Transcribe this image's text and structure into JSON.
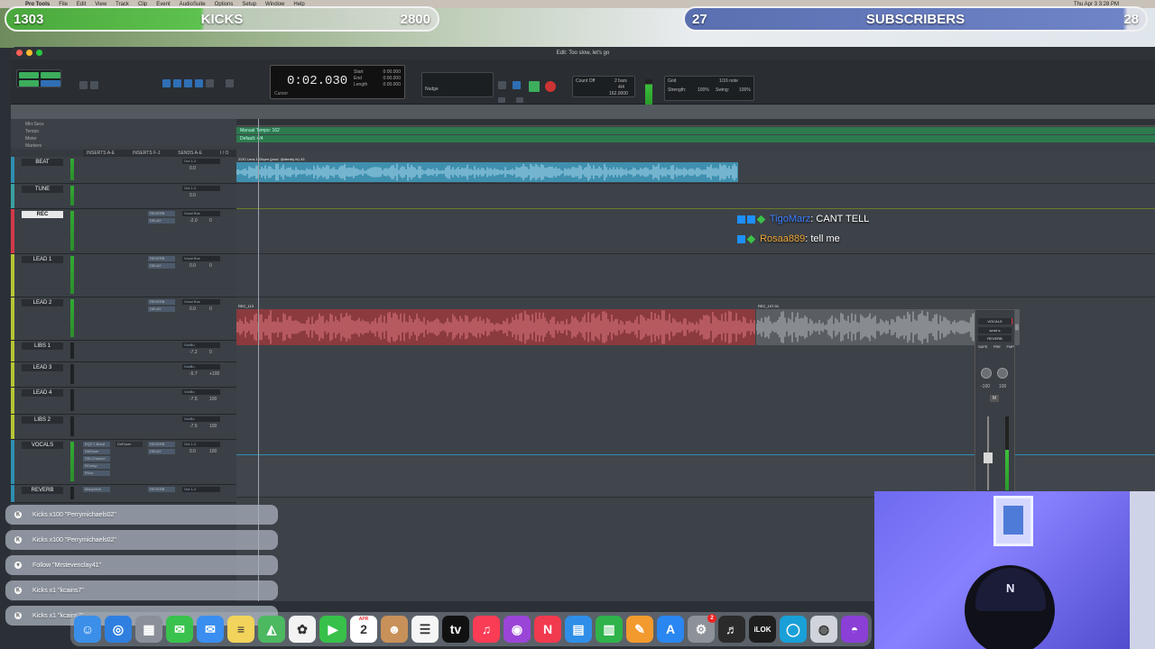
{
  "menubar": {
    "items": [
      "Pro Tools",
      "File",
      "Edit",
      "View",
      "Track",
      "Clip",
      "Event",
      "AudioSuite",
      "Options",
      "Setup",
      "Window",
      "Help"
    ],
    "clock": "Thu Apr 3  3:28 PM"
  },
  "overlays": {
    "kicks_goal": {
      "current": "1303",
      "label": "KICKS",
      "target": "2800",
      "progress": 0.47
    },
    "subs_goal": {
      "current": "27",
      "label": "SUBSCRIBERS",
      "target": "28",
      "progress": 0.96
    }
  },
  "window": {
    "title": "Edit: Too slow, let's go",
    "counter_main": "0:02.030",
    "counter_label": "Cursor",
    "sel_labels": [
      "Start",
      "End",
      "Length"
    ],
    "sel_values": [
      "0:00.000",
      "0:00.000",
      "0:00.000"
    ],
    "nudge_label": "Nudge",
    "grid_label": "Grid",
    "grid_value": "1/16 note",
    "strength_label": "Strength:",
    "strength_value": "100%",
    "swing_label": "Swing:",
    "swing_value": "100%",
    "tempo_value": "162.0000",
    "meter_value": "4/4",
    "count_off": "Count Off",
    "bars": "2 bars"
  },
  "rulers": [
    "Min:Secs",
    "Tempo",
    "Meter",
    "Markers"
  ],
  "ruler_values": {
    "tempo": "Manual Tempo: 162",
    "meter": "Default: 4/4"
  },
  "column_headers": [
    "INSERTS A-E",
    "INSERTS F-J",
    "SENDS A-E",
    "I / O"
  ],
  "tracks": [
    {
      "name": "BEAT",
      "io": "Out 1-2",
      "vol": "0.0",
      "color": "#2e8fb0",
      "active": false
    },
    {
      "name": "TUNE",
      "io": "Out 1-2",
      "vol": "0.0",
      "color": "#3aa0a0",
      "active": false
    },
    {
      "name": "REC",
      "io": "Vocal Bus",
      "send1": "REVERB",
      "send2": "DELAY",
      "vol": "-2.0",
      "pan": "0",
      "color": "#d23a48",
      "active": true
    },
    {
      "name": "LEAD 1",
      "io": "Vocal Bus",
      "send1": "REVERB",
      "send2": "DELAY",
      "vol": "0.0",
      "pan": "0",
      "color": "#b6c534",
      "active": false
    },
    {
      "name": "LEAD 2",
      "io": "Vocal Bus",
      "send1": "REVERB",
      "send2": "DELAY",
      "vol": "0.0",
      "pan": "0",
      "color": "#b6c534",
      "active": false
    },
    {
      "name": "LIBS 1",
      "io": "VoxBu",
      "vol": "-7.2",
      "pan": "0",
      "color": "#b6c534",
      "active": false
    },
    {
      "name": "LEAD 3",
      "io": "VoxBu",
      "vol": "-5.7",
      "pan": "+100",
      "color": "#b6c534",
      "active": false
    },
    {
      "name": "LEAD 4",
      "io": "VoxBu",
      "vol": "-7.5",
      "pan": "100",
      "color": "#b6c534",
      "active": false
    },
    {
      "name": "LIBS 2",
      "io": "VoxBu",
      "vol": "-7.5",
      "pan": "100",
      "color": "#b6c534",
      "active": false
    },
    {
      "name": "VOCALS",
      "io": "Out 1-2",
      "inserts": [
        "EQ3 7-Band",
        "DeEsser",
        "SSLChannel",
        "RComp",
        "RVox"
      ],
      "insert_b": "DeEsser",
      "send1": "REVERB",
      "send2": "DELAY",
      "vol": "0.0",
      "pan": "100",
      "color": "#2e8fb0",
      "active": false
    },
    {
      "name": "REVERB",
      "io": "Out 1-2",
      "insert": "ManyVerb",
      "send1": "REVERB",
      "color": "#2e8fb0",
      "active": false
    }
  ],
  "clips": [
    {
      "track": "BEAT",
      "name": "ZOO Lens 162bpm (prod. @drezily fx) 43",
      "color": "#3f8fae",
      "wave": "#a8d8ee"
    },
    {
      "track": "REC",
      "name": "REC_113",
      "color": "#8b3a3e",
      "wave": "#e27a82"
    },
    {
      "track": "REC",
      "name": "REC_107-01",
      "color": "#5a5e63",
      "wave": "#b7bbbf"
    }
  ],
  "chat": [
    {
      "user": "TigoMarz",
      "message": ": CANT TELL"
    },
    {
      "user": "Rosaa889",
      "message": ": tell me"
    }
  ],
  "float_mixer": {
    "name": "VOCALS",
    "send": "send a",
    "dest": "REVERB",
    "labels": [
      "SAFE",
      "PRE",
      "FMP"
    ],
    "pan_l": "-100",
    "pan_r": "100",
    "mute": "M"
  },
  "alerts": [
    {
      "icon": "K",
      "text": "Kicks x100 \"Perrymichaels02\""
    },
    {
      "icon": "K",
      "text": "Kicks x100 \"Perrymichaels02\""
    },
    {
      "icon": "♥",
      "text": "Follow \"Mrstevenclay41\""
    },
    {
      "icon": "K",
      "text": "Kicks x1 \"kcains7\""
    },
    {
      "icon": "K",
      "text": "Kicks x1 \"kcains7\""
    }
  ],
  "dock": {
    "apps": [
      {
        "name": "finder",
        "glyph": "☺",
        "color": "#3b8fe8"
      },
      {
        "name": "safari",
        "glyph": "◎",
        "color": "#2f7fe0"
      },
      {
        "name": "launchpad",
        "glyph": "▦",
        "color": "#8a8f99"
      },
      {
        "name": "messages",
        "glyph": "✉",
        "color": "#39c24e"
      },
      {
        "name": "mail",
        "glyph": "✉",
        "color": "#3a8ef0"
      },
      {
        "name": "notes",
        "glyph": "≡",
        "color": "#f2d35b"
      },
      {
        "name": "maps",
        "glyph": "◭",
        "color": "#4cb860"
      },
      {
        "name": "photos",
        "glyph": "✿",
        "color": "#f3f3f3"
      },
      {
        "name": "facetime",
        "glyph": "▶",
        "color": "#37c04a"
      },
      {
        "name": "calendar",
        "glyph": "2",
        "color": "#ffffff"
      },
      {
        "name": "contacts",
        "glyph": "☻",
        "color": "#c8915a"
      },
      {
        "name": "reminders",
        "glyph": "☰",
        "color": "#f5f5f5"
      },
      {
        "name": "tv",
        "glyph": "tv",
        "color": "#111111"
      },
      {
        "name": "music",
        "glyph": "♫",
        "color": "#fa3c55"
      },
      {
        "name": "podcasts",
        "glyph": "◉",
        "color": "#9b45d8"
      },
      {
        "name": "news",
        "glyph": "N",
        "color": "#f23a4f"
      },
      {
        "name": "keynote",
        "glyph": "▤",
        "color": "#2f8fe8"
      },
      {
        "name": "numbers",
        "glyph": "▥",
        "color": "#2fb34a"
      },
      {
        "name": "pages",
        "glyph": "✎",
        "color": "#f29a2e"
      },
      {
        "name": "app-store",
        "glyph": "A",
        "color": "#2a86f0"
      },
      {
        "name": "system-settings",
        "glyph": "⚙",
        "color": "#8d9299",
        "badge": "2"
      },
      {
        "name": "logic",
        "glyph": "♬",
        "color": "#2b2b2b"
      },
      {
        "name": "ilok",
        "glyph": "iLOK",
        "color": "#1e1e1e"
      },
      {
        "name": "obs-circle",
        "glyph": "◯",
        "color": "#19a0d8"
      },
      {
        "name": "disk-utility",
        "glyph": "◍",
        "color": "#d0d4da"
      },
      {
        "name": "pro-tools",
        "glyph": "◓",
        "color": "#8b3fd6"
      }
    ],
    "calendar_month": "APR"
  },
  "webcam": {
    "cap_logo": "N"
  }
}
